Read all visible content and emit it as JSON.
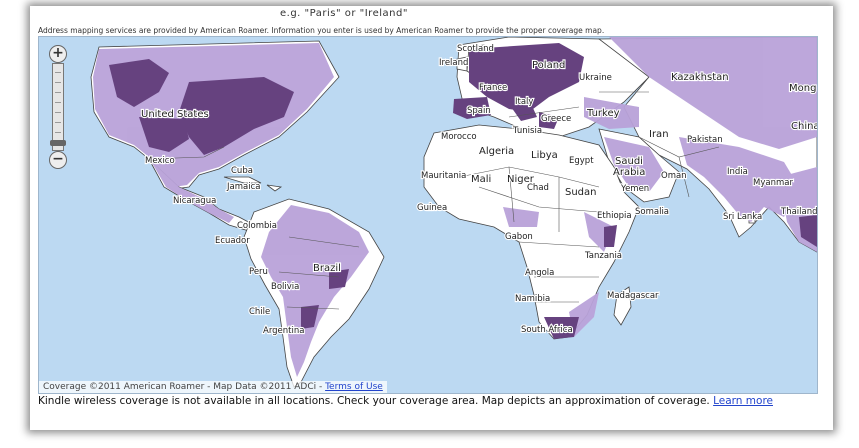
{
  "search": {
    "example_hint": "e.g. \"Paris\" or \"Ireland\""
  },
  "notice": "Address mapping services are provided by American Roamer. Information you enter is used by American Roamer to provide the proper coverage map.",
  "map": {
    "colors": {
      "ocean": "#bcd9f2",
      "land": "#ffffff",
      "coverage_light": "#b9a2d9",
      "coverage_dark": "#66427f",
      "borders": "#444444"
    },
    "zoom_in_glyph": "+",
    "zoom_out_glyph": "−",
    "zoom_level_fraction": 0.93,
    "labels": {
      "scotland": "Scotland",
      "ireland": "Ireland",
      "poland": "Poland",
      "france": "France",
      "ukraine": "Ukraine",
      "kazakhstan": "Kazakhstan",
      "mong": "Mong",
      "spain": "Spain",
      "italy": "Italy",
      "greece": "Greece",
      "turkey": "Turkey",
      "iran": "Iran",
      "pakistan": "Pakistan",
      "china": "China",
      "united_states": "United States",
      "morocco": "Morocco",
      "tunisia": "Tunisia",
      "algeria": "Algeria",
      "libya": "Libya",
      "egypt": "Egypt",
      "saudi_arabia_1": "Saudi",
      "saudi_arabia_2": "Arabia",
      "oman": "Oman",
      "india": "India",
      "myanmar": "Myanmar",
      "mexico": "Mexico",
      "cuba": "Cuba",
      "jamaica": "Jamaica",
      "mauritania": "Mauritania",
      "mali": "Mali",
      "niger": "Niger",
      "chad": "Chad",
      "sudan": "Sudan",
      "yemen": "Yemen",
      "nicaragua": "Nicaragua",
      "guinea": "Guinea",
      "ethiopia": "Ethiopia",
      "somalia": "Somalia",
      "sri_lanka": "Sri Lanka",
      "thailand": "Thailand",
      "colombia": "Colombia",
      "ecuador": "Ecuador",
      "gabon": "Gabon",
      "tanzania": "Tanzania",
      "peru": "Peru",
      "brazil": "Brazil",
      "bolivia": "Bolivia",
      "angola": "Angola",
      "chile": "Chile",
      "namibia": "Namibia",
      "madagascar": "Madagascar",
      "argentina": "Argentina",
      "south_africa": "South Africa"
    },
    "credit_text": "Coverage ©2011 American Roamer - Map Data ©2011 ADCi - ",
    "terms_link": "Terms of Use"
  },
  "footer": {
    "text": "Kindle wireless coverage is not available in all locations. Check your coverage area. Map depicts an approximation of coverage. ",
    "learn_more": "Learn more"
  }
}
